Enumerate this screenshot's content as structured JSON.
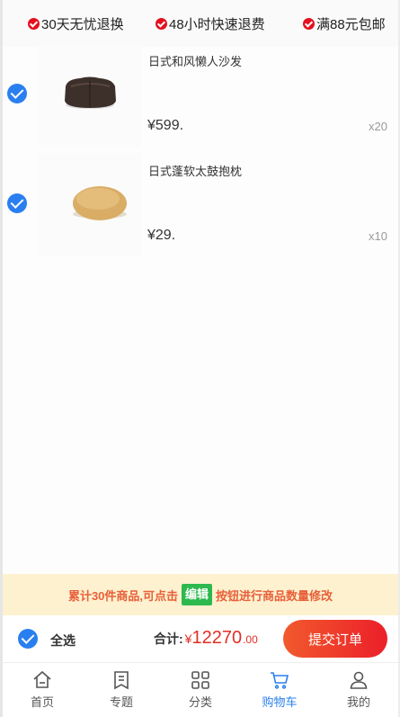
{
  "promises": [
    {
      "icon": "check-circle-icon",
      "text": "30天无忧退换"
    },
    {
      "icon": "check-circle-icon",
      "text": "48小时快速退费"
    },
    {
      "icon": "check-circle-icon",
      "text": "满88元包邮"
    }
  ],
  "cart": {
    "items": [
      {
        "name": "日式和风懒人沙发",
        "price": "¥599.",
        "qty": "x20",
        "checked": true,
        "thumb_icon": "bean-bag-sofa-image"
      },
      {
        "name": "日式蓬软太鼓抱枕",
        "price": "¥29.",
        "qty": "x10",
        "checked": true,
        "thumb_icon": "round-cushion-image"
      }
    ]
  },
  "notice": {
    "before": "累计30件商品,可点击",
    "badge": "编辑",
    "after": "按钮进行商品数量修改"
  },
  "checkout": {
    "select_all_label": "全选",
    "total_label": "合计:",
    "currency": "¥",
    "amount": "12270",
    "decimals": ".00",
    "submit_label": "提交订单"
  },
  "tabbar": {
    "active": "购物车",
    "tabs": [
      {
        "label": "首页",
        "icon": "home-icon"
      },
      {
        "label": "专题",
        "icon": "bookmark-icon"
      },
      {
        "label": "分类",
        "icon": "grid-icon"
      },
      {
        "label": "购物车",
        "icon": "cart-icon"
      },
      {
        "label": "我的",
        "icon": "user-icon"
      }
    ]
  },
  "colors": {
    "accent_blue": "#2a7ff0",
    "price_red": "#e02e24",
    "notice_bg": "#fdf1cf",
    "notice_text": "#e8603a",
    "badge_green": "#2db94d"
  }
}
